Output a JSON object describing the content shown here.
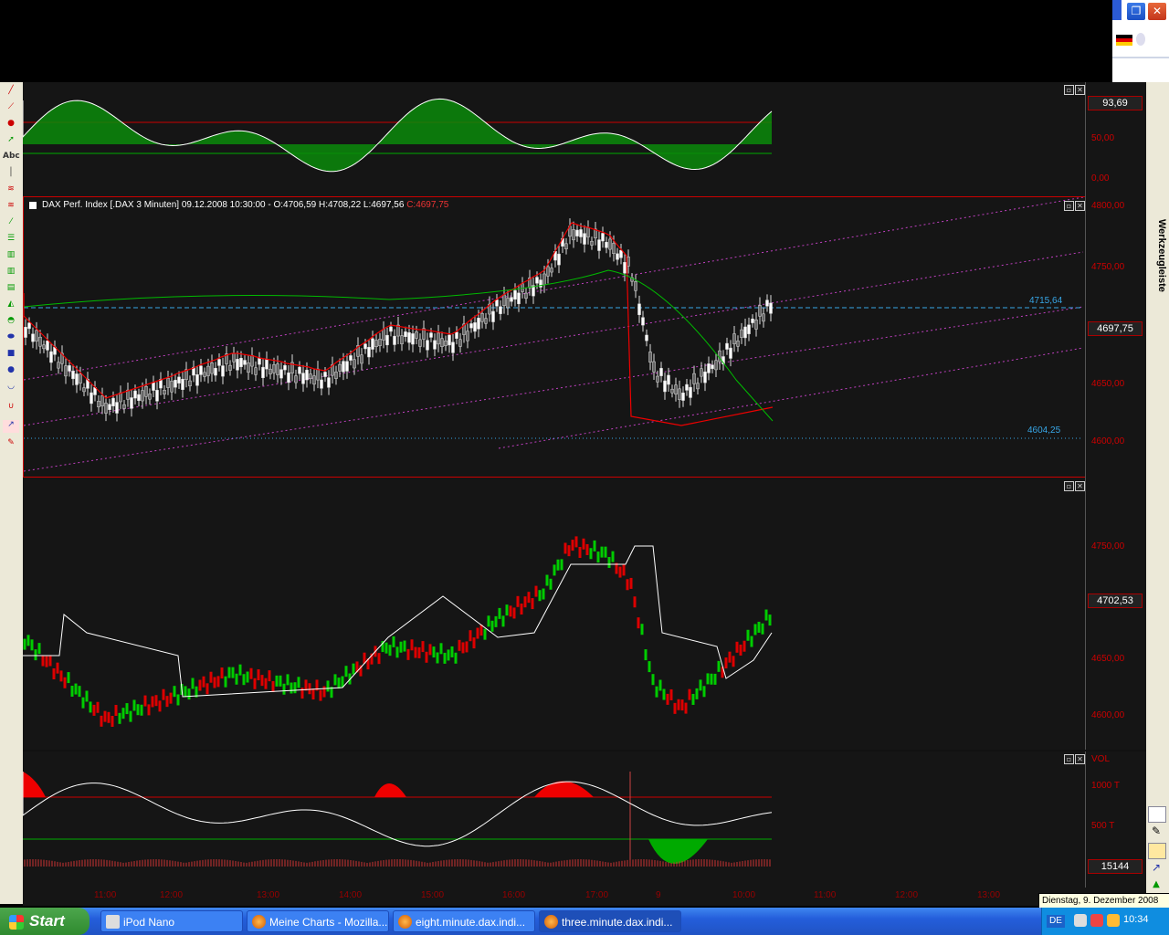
{
  "window": {
    "restore_glyph": "❐",
    "close_glyph": "✕"
  },
  "left_toolbar": {
    "text_tool_label": "Abc"
  },
  "right_toolbar": {
    "label": "Werkzeugleiste"
  },
  "panels": {
    "oscillator_top": {
      "value": "93,69",
      "ticks": [
        "50,00",
        "0,00"
      ]
    },
    "price_main": {
      "title_white": "DAX Perf. Index [.DAX  3 Minuten] 09.12.2008 10:30:00 - ",
      "title_open": "O:4706,59 H:4708,22 L:4697,56 ",
      "title_close": "C:4697,75",
      "line_upper_label": "4715,64",
      "line_lower_label": "4604,25",
      "value": "4697,75",
      "ticks": [
        "4800,00",
        "4750,00",
        "4700,00",
        "4650,00",
        "4600,00"
      ]
    },
    "price_colored": {
      "value": "4702,53",
      "ticks": [
        "4750,00",
        "4700,00",
        "4650,00",
        "4600,00"
      ]
    },
    "volume": {
      "header": "VOL",
      "value": "15144",
      "ticks": [
        "1000 T",
        "500 T"
      ]
    }
  },
  "time_axis": [
    "11:00",
    "12:00",
    "13:00",
    "14:00",
    "15:00",
    "16:00",
    "17:00",
    "9",
    "10:00",
    "11:00",
    "12:00",
    "13:00"
  ],
  "date_tooltip": "Dienstag, 9. Dezember 2008",
  "taskbar": {
    "start_label": "Start",
    "tasks": [
      {
        "label": "iPod Nano"
      },
      {
        "label": "Meine Charts - Mozilla..."
      },
      {
        "label": "eight.minute.dax.indi..."
      },
      {
        "label": "three.minute.dax.indi..."
      }
    ],
    "language": "DE",
    "clock": "10:34"
  },
  "colors": {
    "green": "#0a8a0a",
    "red": "#e00000",
    "cyan": "#37a6e6",
    "magenta": "#c040c0"
  }
}
